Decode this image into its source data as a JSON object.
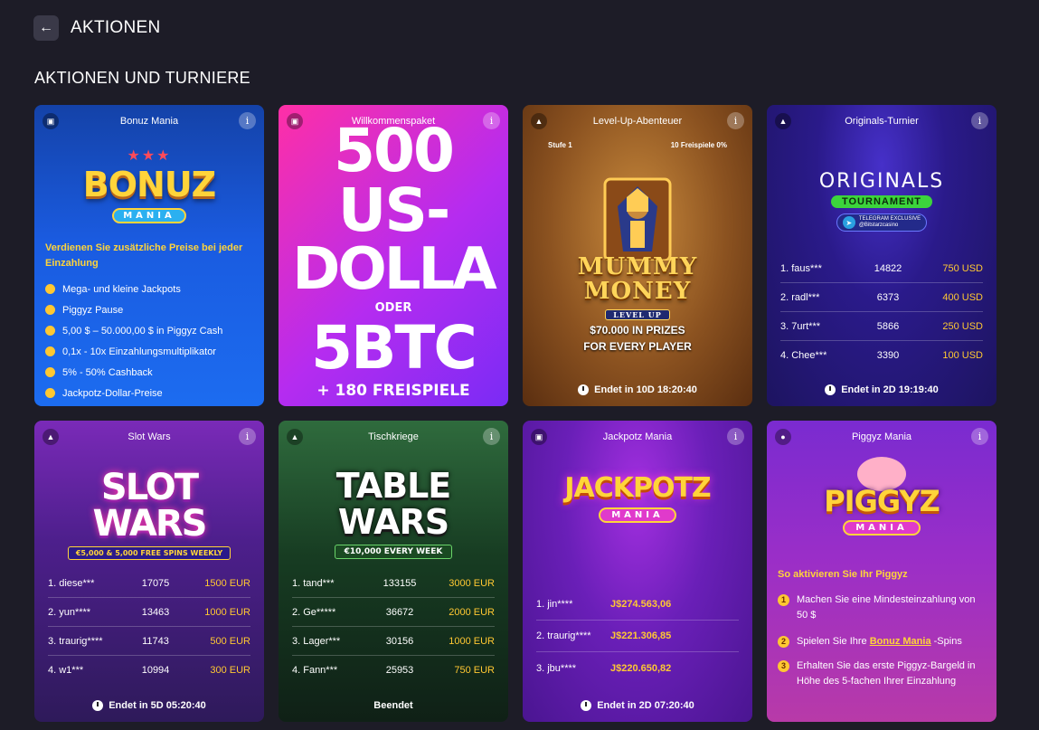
{
  "header": {
    "back_icon": "arrow-left-icon",
    "title": "AKTIONEN"
  },
  "section_title": "AKTIONEN UND TURNIERE",
  "cards": [
    {
      "title": "Bonuz Mania",
      "logo_main": "BONUZ",
      "logo_sub": "MANIA",
      "description": "Verdienen Sie zusätzliche Preise bei jeder Einzahlung",
      "features": [
        "Mega- und kleine Jackpots",
        "Piggyz Pause",
        "5,00 $ – 50.000,00 $ in Piggyz Cash",
        "0,1x - 10x Einzahlungsmultiplikator",
        "5% - 50% Cashback",
        "Jackpotz-Dollar-Preise"
      ]
    },
    {
      "title": "Willkommenspaket",
      "line1": "500",
      "line2": "US-",
      "line3": "DOLLA",
      "line4": "ODER",
      "line5": "5BTC",
      "line6": "+ 180 FREISPIELE"
    },
    {
      "title": "Level-Up-Abenteuer",
      "stage": "Stufe 1",
      "progress": "10 Freispiele 0%",
      "game_line1": "MUMMY",
      "game_line2": "MONEY",
      "game_sub": "LEVEL UP",
      "prize_line1": "$70.000 IN PRIZES",
      "prize_line2": "FOR EVERY PLAYER",
      "footer": "Endet in 10D 18:20:40"
    },
    {
      "title": "Originals-Turnier",
      "logo_main": "ORIGINALS",
      "logo_sub": "TOURNAMENT",
      "tg_line1": "TELEGRAM EXCLUSIVE",
      "tg_line2": "@Bitstarzcasino",
      "leaderboard": [
        {
          "name": "1. faus***",
          "score": "14822",
          "prize": "750 USD"
        },
        {
          "name": "2. radl***",
          "score": "6373",
          "prize": "400 USD"
        },
        {
          "name": "3. 7urt***",
          "score": "5866",
          "prize": "250 USD"
        },
        {
          "name": "4. Chee***",
          "score": "3390",
          "prize": "100 USD"
        }
      ],
      "footer": "Endet in 2D 19:19:40"
    },
    {
      "title": "Slot Wars",
      "logo_line1": "SLOT",
      "logo_line2": "WARS",
      "logo_sub": "€5,000 & 5,000 FREE SPINS WEEKLY",
      "leaderboard": [
        {
          "name": "1. diese***",
          "score": "17075",
          "prize": "1500 EUR"
        },
        {
          "name": "2. yun****",
          "score": "13463",
          "prize": "1000 EUR"
        },
        {
          "name": "3. traurig****",
          "score": "11743",
          "prize": "500 EUR"
        },
        {
          "name": "4. w1***",
          "score": "10994",
          "prize": "300 EUR"
        }
      ],
      "footer": "Endet in 5D 05:20:40"
    },
    {
      "title": "Tischkriege",
      "logo_line1": "TABLE",
      "logo_line2": "WARS",
      "logo_sub": "€10,000 EVERY WEEK",
      "leaderboard": [
        {
          "name": "1. tand***",
          "score": "133155",
          "prize": "3000 EUR"
        },
        {
          "name": "2. Ge*****",
          "score": "36672",
          "prize": "2000 EUR"
        },
        {
          "name": "3. Lager***",
          "score": "30156",
          "prize": "1000 EUR"
        },
        {
          "name": "4. Fann***",
          "score": "25953",
          "prize": "750 EUR"
        }
      ],
      "footer": "Beendet"
    },
    {
      "title": "Jackpotz Mania",
      "logo_main": "JACKPOTZ",
      "logo_sub": "MANIA",
      "winners": [
        {
          "name": "1. jin****",
          "amount": "J$274.563,06"
        },
        {
          "name": "2. traurig****",
          "amount": "J$221.306,85"
        },
        {
          "name": "3. jbu****",
          "amount": "J$220.650,82"
        }
      ],
      "footer": "Endet in 2D 07:20:40"
    },
    {
      "title": "Piggyz Mania",
      "logo_main": "PIGGYZ",
      "logo_sub": "MANIA",
      "howto": "So aktivieren Sie Ihr Piggyz",
      "step1": "Machen Sie eine Mindesteinzahlung von 50 $",
      "step2_pre": "Spielen Sie Ihre",
      "step2_link": "Bonuz Mania",
      "step2_post": "-Spins",
      "step3": "Erhalten Sie das erste Piggyz-Bargeld in Höhe des 5-fachen Ihrer Einzahlung"
    }
  ]
}
